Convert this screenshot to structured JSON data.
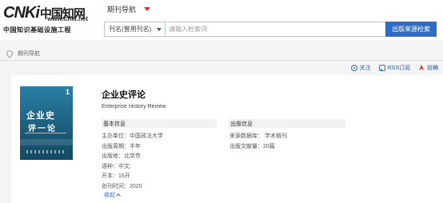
{
  "header": {
    "logo_text": "CNKi",
    "logo_cn": "中国知网",
    "logo_url": "www.cnki.net",
    "logo_sub": "中国知识基础设施工程",
    "nav_title": "期刊导航"
  },
  "search": {
    "field_select": "刊名(曾用刊名)",
    "placeholder": "请输入检索词",
    "button": "出版来源检索"
  },
  "breadcrumb": {
    "label": "期刊导航"
  },
  "actions": {
    "follow": "关注",
    "rss": "RSS订阅",
    "submit": "投稿"
  },
  "journal": {
    "title": "企业史评论",
    "title_en": "Enterprise History Review",
    "cover": {
      "title_line1": "企业史",
      "title_line2": "评一论",
      "issue": "1"
    },
    "basic_info_header": "基本信息",
    "publication_header": "出版信息",
    "basic_info": [
      "主办单位：中国政法大学",
      "出版周期：半年",
      "出版地：北京市",
      "语种：中文;",
      "开本：16开",
      "创刊时间：2020"
    ],
    "publication_info": [
      "来源数据库： 学术辑刊",
      "出版文献量：20篇"
    ],
    "collapse_label": "收起"
  },
  "colors": {
    "brand_blue": "#2f6dc5",
    "accent_red": "#d9322d",
    "cover_teal": "#1f5f7e"
  }
}
